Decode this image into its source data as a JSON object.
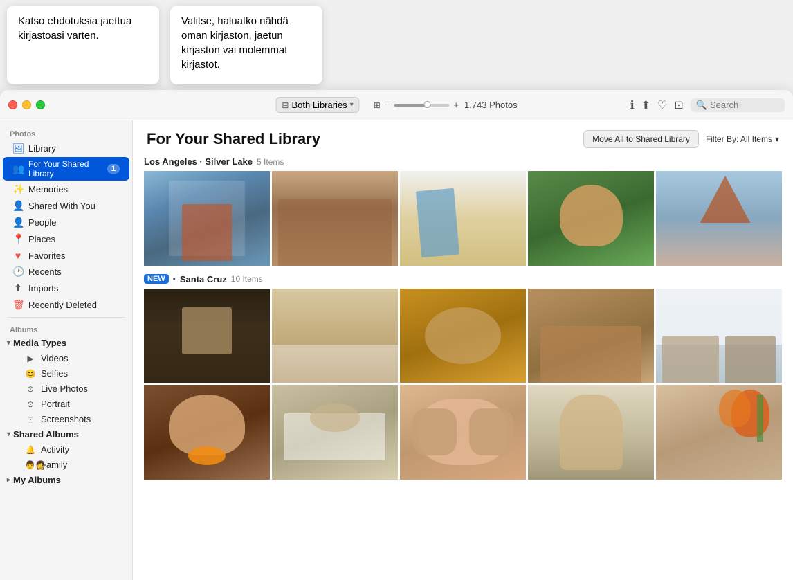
{
  "tooltips": [
    {
      "id": "tooltip-1",
      "text": "Katso ehdotuksia jaettua kirjastoasi varten."
    },
    {
      "id": "tooltip-2",
      "text": "Valitse, haluatko nähdä oman kirjaston, jaetun kirjaston vai molemmat kirjastot."
    }
  ],
  "titlebar": {
    "library_selector_label": "Both Libraries",
    "photo_count": "1,743 Photos",
    "search_placeholder": "Search"
  },
  "sidebar": {
    "photos_section_label": "Photos",
    "albums_section_label": "Albums",
    "photos_items": [
      {
        "id": "library",
        "label": "Library",
        "icon": "🖼",
        "badge": null
      },
      {
        "id": "for-your-shared-library",
        "label": "For Your Shared Library",
        "icon": "👥",
        "badge": "1",
        "active": true
      },
      {
        "id": "memories",
        "label": "Memories",
        "icon": "✨",
        "badge": null
      },
      {
        "id": "shared-with-you",
        "label": "Shared With You",
        "icon": "👤",
        "badge": null
      },
      {
        "id": "people",
        "label": "People",
        "icon": "👤",
        "badge": null
      },
      {
        "id": "places",
        "label": "Places",
        "icon": "📍",
        "badge": null
      },
      {
        "id": "favorites",
        "label": "Favorites",
        "icon": "♥",
        "badge": null
      },
      {
        "id": "recents",
        "label": "Recents",
        "icon": "🕐",
        "badge": null
      },
      {
        "id": "imports",
        "label": "Imports",
        "icon": "⬆",
        "badge": null
      },
      {
        "id": "recently-deleted",
        "label": "Recently Deleted",
        "icon": "🗑",
        "badge": null
      }
    ],
    "albums_groups": [
      {
        "id": "media-types",
        "label": "Media Types",
        "expanded": true,
        "items": [
          {
            "id": "videos",
            "label": "Videos",
            "icon": "▶"
          },
          {
            "id": "selfies",
            "label": "Selfies",
            "icon": "😊"
          },
          {
            "id": "live-photos",
            "label": "Live Photos",
            "icon": "⊙"
          },
          {
            "id": "portrait",
            "label": "Portrait",
            "icon": "⊙"
          },
          {
            "id": "screenshots",
            "label": "Screenshots",
            "icon": "⊡"
          }
        ]
      },
      {
        "id": "shared-albums",
        "label": "Shared Albums",
        "expanded": true,
        "items": [
          {
            "id": "activity",
            "label": "Activity",
            "icon": "🔔"
          },
          {
            "id": "family",
            "label": "Family",
            "icon": "👨‍👩"
          }
        ]
      },
      {
        "id": "my-albums",
        "label": "My Albums",
        "expanded": false,
        "items": []
      }
    ]
  },
  "content": {
    "title": "For Your Shared Library",
    "move_all_btn": "Move All to Shared Library",
    "filter_label": "Filter By: All Items",
    "sections": [
      {
        "id": "los-angeles",
        "location": "Los Angeles · Silver Lake",
        "item_count": "5 Items",
        "is_new": false,
        "photos": [
          {
            "id": "p1",
            "color_class": "photo-blue-gray",
            "description": "child at window with blue tape"
          },
          {
            "id": "p2",
            "color_class": "photo-warm-brown",
            "description": "two children sitting"
          },
          {
            "id": "p3",
            "color_class": "photo-yellow-warm",
            "description": "child with guitar"
          },
          {
            "id": "p4",
            "color_class": "photo-green-outdoor",
            "description": "smiling child outdoors"
          },
          {
            "id": "p5",
            "color_class": "photo-blue-sky",
            "description": "child with cone shape"
          }
        ]
      },
      {
        "id": "santa-cruz",
        "location": "Santa Cruz",
        "item_count": "10 Items",
        "is_new": true,
        "photos": [
          {
            "id": "p6",
            "color_class": "photo-dark-kitchen",
            "description": "child baking in dark kitchen"
          },
          {
            "id": "p7",
            "color_class": "photo-light-kitchen",
            "description": "woman at table with flour"
          },
          {
            "id": "p8",
            "color_class": "photo-gold-fabric",
            "description": "close up gold fabric child"
          },
          {
            "id": "p9",
            "color_class": "photo-warm-room",
            "description": "child at warm room"
          },
          {
            "id": "p10",
            "color_class": "photo-bright-window",
            "description": "two children at bright window"
          },
          {
            "id": "p11",
            "color_class": "photo-child-eating",
            "description": "child eating close up"
          },
          {
            "id": "p12",
            "color_class": "photo-flour-mess",
            "description": "flour on table mess"
          },
          {
            "id": "p13",
            "color_class": "photo-child-face",
            "description": "child covering face with hands"
          },
          {
            "id": "p14",
            "color_class": "photo-woman-stand",
            "description": "woman standing smiling"
          },
          {
            "id": "p15",
            "color_class": "photo-tulips",
            "description": "tulips with child"
          }
        ]
      }
    ]
  },
  "icons": {
    "info": "ℹ",
    "share": "⬆",
    "heart": "♡",
    "rotate": "⊡",
    "search": "🔍",
    "chevron_down": "▾",
    "chevron_right": "▸"
  }
}
